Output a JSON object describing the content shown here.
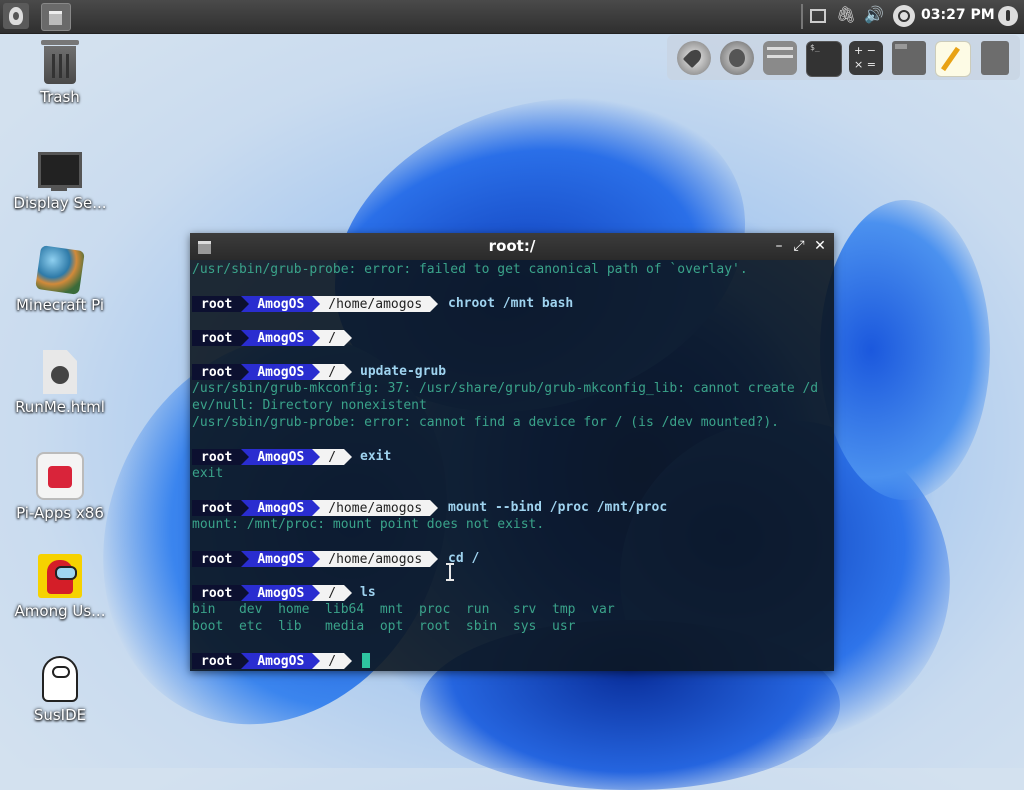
{
  "topbar": {
    "clock": "03:27 PM"
  },
  "dock": {
    "items": [
      "rocket-launcher",
      "firefox",
      "file-archiver",
      "terminal",
      "calculator",
      "file-manager",
      "text-editor",
      "trash"
    ]
  },
  "desktop_icons": [
    {
      "label": "Trash",
      "icon": "trash-icon"
    },
    {
      "label": "Display Se...",
      "icon": "monitor-icon"
    },
    {
      "label": "Minecraft Pi",
      "icon": "minecraft-icon"
    },
    {
      "label": "RunMe.html",
      "icon": "html-file-icon"
    },
    {
      "label": "Pi-Apps x86",
      "icon": "pi-apps-icon"
    },
    {
      "label": "Among Us...",
      "icon": "among-us-icon"
    },
    {
      "label": "SusIDE",
      "icon": "suside-icon"
    }
  ],
  "terminal": {
    "title": "root:/",
    "prompt_user": "root",
    "prompt_host": "AmogOS",
    "lines": {
      "l0": "/usr/sbin/grub-probe: error: failed to get canonical path of `overlay'.",
      "p1_path": "/home/amogos",
      "p1_cmd": "chroot /mnt bash",
      "p2_path": "/",
      "p3_path": "/",
      "p3_cmd": "update-grub",
      "l3a": "/usr/sbin/grub-mkconfig: 37: /usr/share/grub/grub-mkconfig_lib: cannot create /d",
      "l3b": "ev/null: Directory nonexistent",
      "l3c": "/usr/sbin/grub-probe: error: cannot find a device for / (is /dev mounted?).",
      "p4_path": "/",
      "p4_cmd": "exit",
      "l4a": "exit",
      "p5_path": "/home/amogos",
      "p5_cmd": "mount --bind /proc /mnt/proc",
      "l5a": "mount: /mnt/proc: mount point does not exist.",
      "p6_path": "/home/amogos",
      "p6_cmd": "cd /",
      "p7_path": "/",
      "p7_cmd": "ls",
      "l7a": "bin   dev  home  lib64  mnt  proc  run   srv  tmp  var",
      "l7b": "boot  etc  lib   media  opt  root  sbin  sys  usr",
      "p8_path": "/"
    }
  }
}
